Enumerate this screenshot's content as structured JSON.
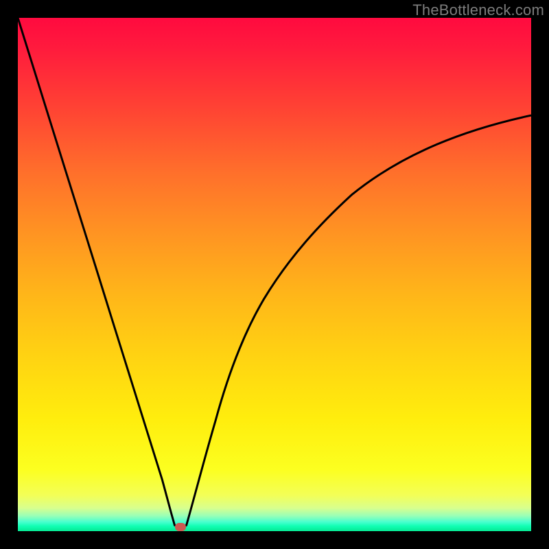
{
  "watermark": {
    "text": "TheBottleneck.com"
  },
  "chart_data": {
    "type": "line",
    "title": "",
    "xlabel": "",
    "ylabel": "",
    "series": [
      {
        "name": "left-branch",
        "x": [
          0,
          0.031,
          0.062,
          0.094,
          0.125,
          0.156,
          0.188,
          0.219,
          0.25,
          0.281,
          0.299,
          0.306
        ],
        "values": [
          1.0,
          0.9,
          0.8,
          0.7,
          0.6,
          0.5,
          0.4,
          0.3,
          0.2,
          0.1,
          0.034,
          0.01
        ]
      },
      {
        "name": "right-branch",
        "x": [
          0.328,
          0.345,
          0.364,
          0.385,
          0.41,
          0.44,
          0.48,
          0.53,
          0.59,
          0.65,
          0.73,
          0.84,
          1.0
        ],
        "values": [
          0.01,
          0.073,
          0.143,
          0.215,
          0.29,
          0.37,
          0.453,
          0.53,
          0.6,
          0.655,
          0.708,
          0.757,
          0.81
        ]
      }
    ],
    "xlim": [
      0,
      1
    ],
    "ylim": [
      0,
      1
    ],
    "grid": false,
    "legend": false,
    "marker": {
      "x": 0.317,
      "y": 0.0,
      "color": "#cc5a52"
    },
    "background_gradient": {
      "stops": [
        {
          "pos": 0.0,
          "color": "#ff0a3f"
        },
        {
          "pos": 0.5,
          "color": "#ffb619"
        },
        {
          "pos": 0.9,
          "color": "#fcff20"
        },
        {
          "pos": 1.0,
          "color": "#06e893"
        }
      ]
    }
  }
}
